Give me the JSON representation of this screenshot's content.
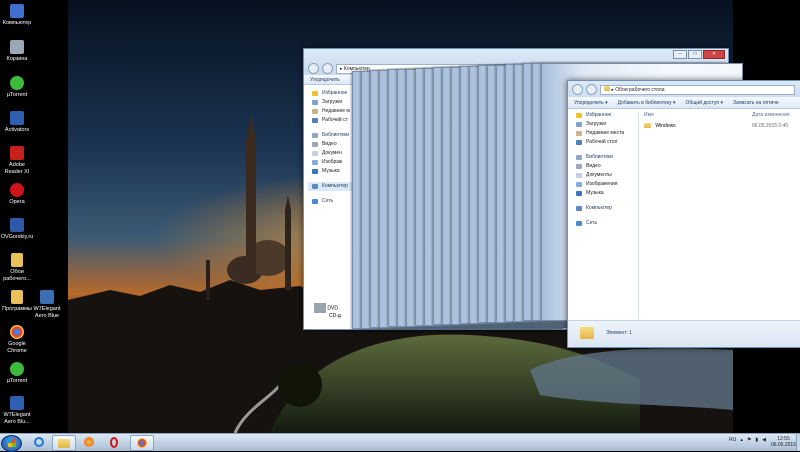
{
  "desktop": {
    "icons": [
      {
        "label": "Компьютер",
        "color": "#3f6fcf"
      },
      {
        "label": "Корзина",
        "color": "#9aa8b6"
      },
      {
        "label": "µTorrent",
        "color": "#3dbb3d"
      },
      {
        "label": "Activators",
        "color": "#2e5fb0"
      },
      {
        "label": "Adobe Reader XI",
        "color": "#c8201c"
      },
      {
        "label": "Opera",
        "color": "#d0141c"
      },
      {
        "label": "OVGorskiy.ru",
        "color": "#2d59a8"
      },
      {
        "label": "Обои рабочего...",
        "color": "#e9c15a"
      },
      {
        "label": "Программы",
        "color": "#e9c15a"
      },
      {
        "label": "W7Elegant Aero Blue",
        "color": "#3b6fb4"
      },
      {
        "label": "Google Chrome",
        "color": "#e7463a"
      },
      {
        "label": "µTorrent",
        "color": "#3dbb3d"
      },
      {
        "label": "W7Elegant Aero Blu...",
        "color": "#2e5fb0"
      }
    ]
  },
  "back_window": {
    "address": "Компьютер",
    "toolbar_label": "Упорядочить",
    "nav": {
      "favorites": "Избранное",
      "downloads": "Загрузки",
      "recent": "Недавние м",
      "desktop": "Рабочий ст",
      "libraries": "Библиотеки",
      "video": "Видео",
      "documents": "Докумен",
      "images": "Изображ",
      "music": "Музыка",
      "computer": "Компьютер",
      "network": "Сеть"
    },
    "drive_label": "DVD",
    "drive_sub": "CD-д"
  },
  "front_window": {
    "address": "Обои рабочего стола",
    "toolbar": {
      "organize": "Упорядочить ▾",
      "add_library": "Добавить в библиотеку ▾",
      "share": "Общий доступ ▾",
      "burn": "Записать на оптиче"
    },
    "columns": {
      "name": "Имя",
      "date": "Дата изменения"
    },
    "files": [
      {
        "name": "Windows",
        "date": "06.05.2015 0:40"
      }
    ],
    "nav": {
      "favorites": "Избранное",
      "downloads": "Загрузки",
      "recent": "Недавние места",
      "desktop": "Рабочий стол",
      "libraries": "Библиотеки",
      "video": "Видео",
      "documents": "Документы",
      "images": "Изображения",
      "music": "Музыка",
      "computer": "Компьютер",
      "network": "Сеть"
    },
    "status": "Элемент: 1"
  },
  "taskbar": {
    "lang": "RU",
    "time": "12:55",
    "date": "06.05.2015"
  }
}
